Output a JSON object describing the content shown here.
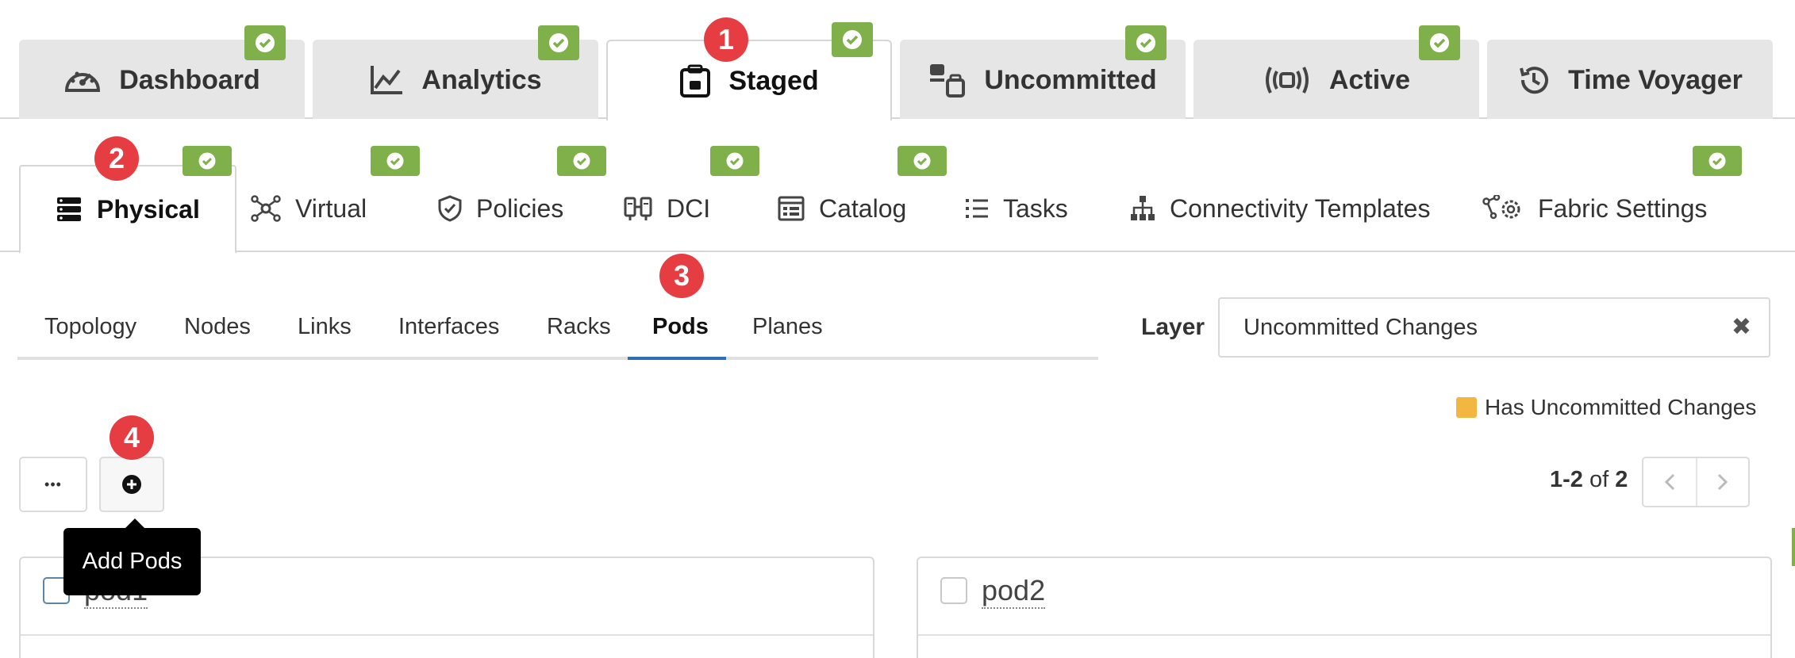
{
  "top_tabs": [
    {
      "label": "Dashboard",
      "icon": "dashboard-gauge-icon",
      "active": false
    },
    {
      "label": "Analytics",
      "icon": "line-chart-icon",
      "active": false
    },
    {
      "label": "Staged",
      "icon": "staged-lock-icon",
      "active": true
    },
    {
      "label": "Uncommitted",
      "icon": "uncommitted-icon",
      "active": false
    },
    {
      "label": "Active",
      "icon": "active-broadcast-icon",
      "active": false
    },
    {
      "label": "Time Voyager",
      "icon": "history-icon",
      "active": false
    }
  ],
  "sub_tabs": [
    {
      "label": "Physical",
      "icon": "server-stack-icon",
      "active": true
    },
    {
      "label": "Virtual",
      "icon": "network-nodes-icon",
      "active": false
    },
    {
      "label": "Policies",
      "icon": "shield-check-icon",
      "active": false
    },
    {
      "label": "DCI",
      "icon": "dci-icon",
      "active": false
    },
    {
      "label": "Catalog",
      "icon": "catalog-icon",
      "active": false
    },
    {
      "label": "Tasks",
      "icon": "list-icon",
      "active": false
    },
    {
      "label": "Connectivity Templates",
      "icon": "hierarchy-icon",
      "active": false
    },
    {
      "label": "Fabric Settings",
      "icon": "fabric-settings-icon",
      "active": false
    }
  ],
  "third_tabs": [
    {
      "label": "Topology",
      "active": false
    },
    {
      "label": "Nodes",
      "active": false
    },
    {
      "label": "Links",
      "active": false
    },
    {
      "label": "Interfaces",
      "active": false
    },
    {
      "label": "Racks",
      "active": false
    },
    {
      "label": "Pods",
      "active": true
    },
    {
      "label": "Planes",
      "active": false
    }
  ],
  "badges": {
    "b1": "1",
    "b2": "2",
    "b3": "3",
    "b4": "4"
  },
  "layer": {
    "label": "Layer",
    "value": "Uncommitted Changes",
    "clear_glyph": "✖"
  },
  "legend": {
    "label": "Has Uncommitted Changes",
    "color": "#f3b640"
  },
  "toolbar": {
    "more_glyph": "•••",
    "tooltip": "Add Pods"
  },
  "pager": {
    "range": "1-2",
    "of_label": "of",
    "total": "2"
  },
  "cards": [
    {
      "name": "pod1"
    },
    {
      "name": "pod2"
    }
  ],
  "colors": {
    "accent": "#2f6fb3",
    "success": "#80b04a",
    "badge": "#e63d42"
  }
}
